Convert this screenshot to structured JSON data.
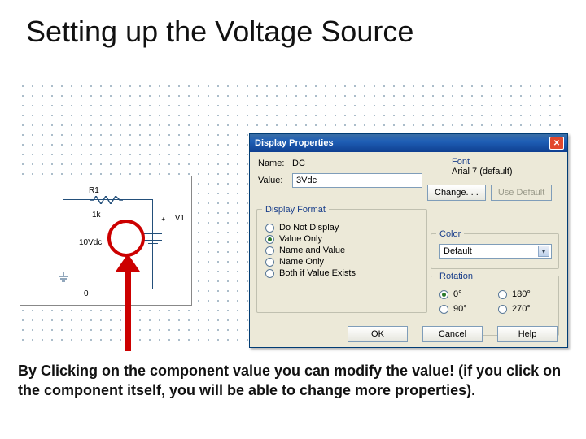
{
  "title": "Setting up the Voltage Source",
  "schematic": {
    "r1_name": "R1",
    "r1_value": "1k",
    "v1_name": "V1",
    "v1_value": "10Vdc",
    "gnd": "0",
    "plus": "+"
  },
  "dialog": {
    "title": "Display Properties",
    "name_label": "Name:",
    "name_value": "DC",
    "value_label": "Value:",
    "value_value": "3Vdc",
    "font": {
      "heading": "Font",
      "current": "Arial 7 (default)",
      "change_btn": "Change. . .",
      "use_default_btn": "Use Default"
    },
    "display_format": {
      "legend": "Display Format",
      "options": [
        "Do Not Display",
        "Value Only",
        "Name and Value",
        "Name Only",
        "Both if Value Exists"
      ],
      "selected": "Value Only"
    },
    "color": {
      "legend": "Color",
      "value": "Default"
    },
    "rotation": {
      "legend": "Rotation",
      "options": [
        "0°",
        "90°",
        "180°",
        "270°"
      ],
      "selected": "0°"
    },
    "ok_btn": "OK",
    "cancel_btn": "Cancel",
    "help_btn": "Help"
  },
  "caption": "By Clicking on the component value you can modify the value! (if you click on the component itself, you will be able to change more properties)."
}
